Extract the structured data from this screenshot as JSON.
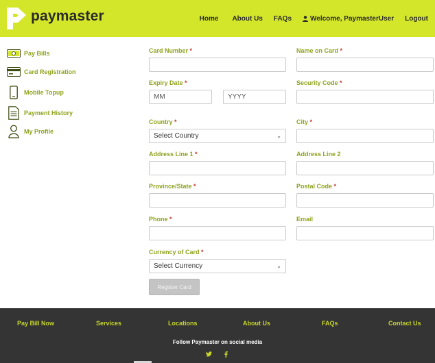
{
  "header": {
    "brand": "paymaster",
    "nav": {
      "home": "Home",
      "about": "About Us",
      "faqs": "FAQs",
      "welcome": "Welcome, PaymasterUser",
      "logout": "Logout"
    }
  },
  "sidebar": {
    "items": [
      {
        "label": "Pay Bills",
        "icon": "money-bill-icon"
      },
      {
        "label": "Card Registration",
        "icon": "credit-card-icon"
      },
      {
        "label": "Mobile Topup",
        "icon": "mobile-phone-icon"
      },
      {
        "label": "Payment History",
        "icon": "document-list-icon"
      },
      {
        "label": "My Profile",
        "icon": "user-icon"
      }
    ]
  },
  "form": {
    "card_number": {
      "label": "Card Number",
      "value": ""
    },
    "name_on_card": {
      "label": "Name on Card",
      "value": ""
    },
    "expiry_date": {
      "label": "Expiry Date",
      "month_placeholder": "MM",
      "year_placeholder": "YYYY"
    },
    "security_code": {
      "label": "Security Code",
      "value": ""
    },
    "country": {
      "label": "Country",
      "selected": "Select Country"
    },
    "city": {
      "label": "City",
      "value": ""
    },
    "address_line_1": {
      "label": "Address Line 1",
      "value": ""
    },
    "address_line_2": {
      "label": "Address Line 2",
      "value": ""
    },
    "province_state": {
      "label": "Province/State",
      "value": ""
    },
    "postal_code": {
      "label": "Postal Code",
      "value": ""
    },
    "phone": {
      "label": "Phone",
      "value": ""
    },
    "email": {
      "label": "Email",
      "value": ""
    },
    "currency": {
      "label": "Currency of Card",
      "selected": "Select Currency"
    },
    "required_marker": "*",
    "submit_label": "Register Card"
  },
  "footer": {
    "links": [
      "Pay Bill Now",
      "Services",
      "Locations",
      "About Us",
      "FAQs",
      "Contact Us"
    ],
    "follow_text": "Follow Paymaster on social media",
    "social": [
      "twitter-icon",
      "facebook-icon"
    ]
  },
  "colors": {
    "brand": "#d4e62a",
    "label": "#8fa21c",
    "footer_bg": "#343434",
    "footer_link": "#c8d62a",
    "required": "#c0392b"
  }
}
